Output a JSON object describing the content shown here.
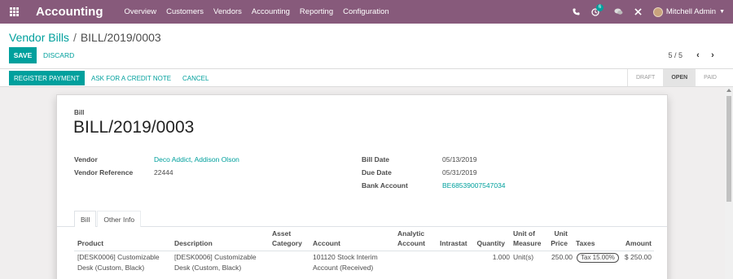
{
  "navbar": {
    "app_title": "Accounting",
    "menu": [
      "Overview",
      "Customers",
      "Vendors",
      "Accounting",
      "Reporting",
      "Configuration"
    ],
    "activity_count": "6",
    "user_name": "Mitchell Admin",
    "color": "#875a7b"
  },
  "breadcrumb": {
    "parent": "Vendor Bills",
    "current": "BILL/2019/0003"
  },
  "buttons": {
    "save": "SAVE",
    "discard": "DISCARD"
  },
  "pager": {
    "value": "5 / 5"
  },
  "statusbar": {
    "register_payment": "REGISTER PAYMENT",
    "credit_note": "ASK FOR A CREDIT NOTE",
    "cancel": "CANCEL",
    "stages": [
      "DRAFT",
      "OPEN",
      "PAID"
    ],
    "active_stage": "OPEN"
  },
  "form": {
    "type_label": "Bill",
    "name": "BILL/2019/0003",
    "vendor_label": "Vendor",
    "vendor": "Deco Addict, Addison Olson",
    "vendor_reference_label": "Vendor Reference",
    "vendor_reference": "22444",
    "bill_date_label": "Bill Date",
    "bill_date": "05/13/2019",
    "due_date_label": "Due Date",
    "due_date": "05/31/2019",
    "bank_account_label": "Bank Account",
    "bank_account": "BE68539007547034"
  },
  "tabs": [
    "Bill",
    "Other Info"
  ],
  "table": {
    "headers": {
      "product": "Product",
      "description": "Description",
      "asset_category_1": "Asset",
      "asset_category_2": "Category",
      "account": "Account",
      "analytic_1": "Analytic",
      "analytic_2": "Account",
      "intrastat": "Intrastat",
      "quantity": "Quantity",
      "uom_1": "Unit of",
      "uom_2": "Measure",
      "price_1": "Unit",
      "price_2": "Price",
      "taxes": "Taxes",
      "amount": "Amount"
    },
    "rows": [
      {
        "product_1": "[DESK0006] Customizable",
        "product_2": "Desk (Custom, Black)",
        "description_1": "[DESK0006] Customizable",
        "description_2": "Desk (Custom, Black)",
        "account_1": "101120 Stock Interim",
        "account_2": "Account (Received)",
        "quantity": "1.000",
        "uom": "Unit(s)",
        "price": "250.00",
        "tax": "Tax 15.00%",
        "amount": "$ 250.00"
      }
    ]
  },
  "accent_color": "#00a09d"
}
